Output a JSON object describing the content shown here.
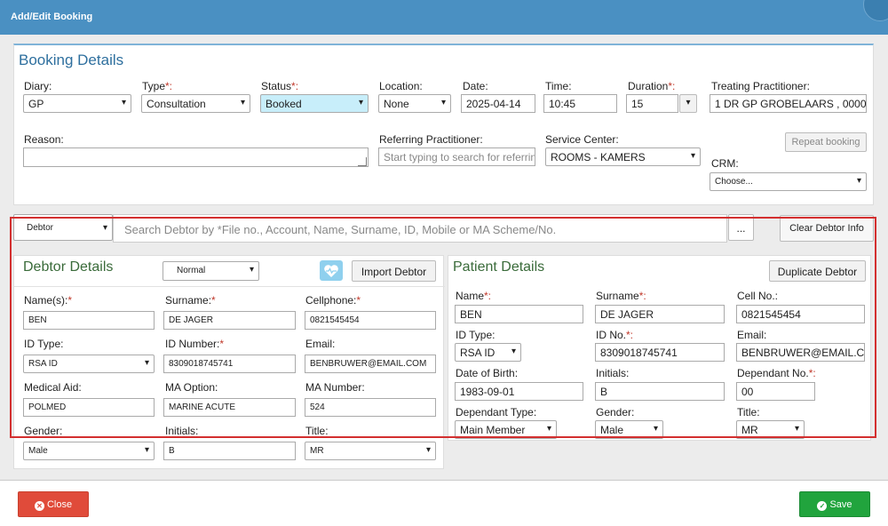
{
  "header": {
    "title": "Add/Edit Booking"
  },
  "booking": {
    "title": "Booking Details",
    "diary": {
      "label": "Diary:",
      "value": "GP"
    },
    "type": {
      "label": "Type",
      "value": "Consultation"
    },
    "status": {
      "label": "Status",
      "value": "Booked"
    },
    "location": {
      "label": "Location:",
      "value": "None"
    },
    "date": {
      "label": "Date:",
      "value": "2025-04-14"
    },
    "time": {
      "label": "Time:",
      "value": "10:45"
    },
    "duration": {
      "label": "Duration",
      "value": "15"
    },
    "treating": {
      "label": "Treating Practitioner:",
      "value": "1 DR GP GROBELAARS , 0000"
    },
    "reason": {
      "label": "Reason:",
      "value": ""
    },
    "referring": {
      "label": "Referring Practitioner:",
      "placeholder": "Start typing to search for referrin"
    },
    "service": {
      "label": "Service Center:",
      "value": "ROOMS - KAMERS"
    },
    "repeat_label": "Repeat booking",
    "crm": {
      "label": "CRM:",
      "value": "Choose..."
    },
    "required_mark": "*:"
  },
  "search": {
    "type": "Debtor",
    "placeholder": "Search Debtor by *File no., Account, Name, Surname, ID, Mobile or MA Scheme/No.",
    "more_label": "...",
    "clear_label": "Clear Debtor Info"
  },
  "debtor": {
    "title": "Debtor Details",
    "mode": "Normal",
    "import_label": "Import Debtor",
    "names": {
      "label": "Name(s):",
      "value": "BEN"
    },
    "surname": {
      "label": "Surname:",
      "value": "DE JAGER"
    },
    "cellphone": {
      "label": "Cellphone:",
      "value": "0821545454"
    },
    "id_type": {
      "label": "ID Type:",
      "value": "RSA ID"
    },
    "id_number": {
      "label": "ID Number:",
      "value": "8309018745741"
    },
    "email": {
      "label": "Email:",
      "value": "BENBRUWER@EMAIL.COM"
    },
    "medical_aid": {
      "label": "Medical Aid:",
      "value": "POLMED"
    },
    "ma_option": {
      "label": "MA Option:",
      "value": "MARINE ACUTE"
    },
    "ma_number": {
      "label": "MA Number:",
      "value": "524"
    },
    "gender": {
      "label": "Gender:",
      "value": "Male"
    },
    "initials": {
      "label": "Initials:",
      "value": "B"
    },
    "title_field": {
      "label": "Title:",
      "value": "MR"
    },
    "required_mark": "*"
  },
  "patient": {
    "title": "Patient Details",
    "duplicate_label": "Duplicate Debtor",
    "name": {
      "label": "Name",
      "value": "BEN"
    },
    "surname": {
      "label": "Surname",
      "value": "DE JAGER"
    },
    "cell": {
      "label": "Cell No.:",
      "value": "0821545454"
    },
    "id_type": {
      "label": "ID Type:",
      "value": "RSA ID"
    },
    "id_no": {
      "label": "ID No.",
      "value": "8309018745741"
    },
    "email": {
      "label": "Email:",
      "value": "BENBRUWER@EMAIL.C"
    },
    "dob": {
      "label": "Date of Birth:",
      "value": "1983-09-01"
    },
    "initials": {
      "label": "Initials:",
      "value": "B"
    },
    "dependant_no": {
      "label": "Dependant No.",
      "value": "00"
    },
    "dependant_type": {
      "label": "Dependant Type:",
      "value": "Main Member"
    },
    "gender": {
      "label": "Gender:",
      "value": "Male"
    },
    "title_field": {
      "label": "Title:",
      "value": "MR"
    },
    "required_mark": "*:"
  },
  "footer": {
    "close_label": "Close",
    "save_label": "Save"
  },
  "icons": {
    "close": "circle-x-icon",
    "save": "check-circle-icon",
    "heart": "heart-pulse-icon"
  },
  "chev": "▾",
  "colors": {
    "header": "#4a90c2",
    "close": "#e04b3a",
    "save": "#21a43d",
    "highlight": "#c8eefa",
    "frame": "#d32f2f"
  }
}
